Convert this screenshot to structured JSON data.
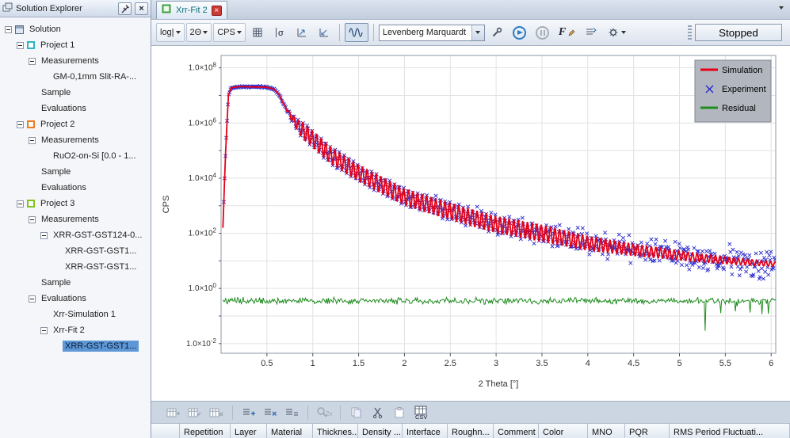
{
  "solution_explorer": {
    "title": "Solution Explorer",
    "close_label": "×",
    "tree": [
      {
        "label": "Solution",
        "level": 0,
        "expand": true,
        "icon": "solution"
      },
      {
        "label": "Project 1",
        "level": 1,
        "expand": true,
        "icon": "#2ab6c4"
      },
      {
        "label": "Measurements",
        "level": 2,
        "expand": true
      },
      {
        "label": "GM-0,1mm Slit-RA-...",
        "level": 3
      },
      {
        "label": "Sample",
        "level": 2
      },
      {
        "label": "Evaluations",
        "level": 2
      },
      {
        "label": "Project 2",
        "level": 1,
        "expand": true,
        "icon": "#f07a1e"
      },
      {
        "label": "Measurements",
        "level": 2,
        "expand": true
      },
      {
        "label": "RuO2-on-Si [0.0 - 1...",
        "level": 3
      },
      {
        "label": "Sample",
        "level": 2
      },
      {
        "label": "Evaluations",
        "level": 2
      },
      {
        "label": "Project 3",
        "level": 1,
        "expand": true,
        "icon": "#7fc41c"
      },
      {
        "label": "Measurements",
        "level": 2,
        "expand": true
      },
      {
        "label": "XRR-GST-GST124-0...",
        "level": 3,
        "expand": true
      },
      {
        "label": "XRR-GST-GST1...",
        "level": 4
      },
      {
        "label": "XRR-GST-GST1...",
        "level": 4
      },
      {
        "label": "Sample",
        "level": 2
      },
      {
        "label": "Evaluations",
        "level": 2,
        "expand": true
      },
      {
        "label": "Xrr-Simulation 1",
        "level": 3
      },
      {
        "label": "Xrr-Fit 2",
        "level": 3,
        "expand": true
      },
      {
        "label": "XRR-GST-GST1...",
        "level": 4,
        "selected": true
      }
    ]
  },
  "tabbar": {
    "active_tab": "Xrr-Fit 2",
    "close_label": "×"
  },
  "toolbar": {
    "log_label": "log|",
    "two_theta_label": "2Θ",
    "cps_label": "CPS",
    "algorithm": "Levenberg Marquardt",
    "f_label": "F",
    "status_button": "Stopped"
  },
  "bottom_toolbar": {
    "zoom_label": "2x",
    "csv_label": "CSV"
  },
  "table": {
    "headers": [
      "Repetition",
      "Layer",
      "Material",
      "Thicknes...",
      "Density ...",
      "Interface",
      "Roughn...",
      "Comment",
      "Color",
      "MNO",
      "PQR",
      "RMS Period Fluctuati..."
    ]
  },
  "chart_data": {
    "type": "line+scatter",
    "xlabel": "2 Theta [°]",
    "ylabel": "CPS",
    "x_min": 0,
    "x_max": 6.05,
    "x_ticks": [
      0.5,
      1,
      1.5,
      2,
      2.5,
      3,
      3.5,
      4,
      4.5,
      5,
      5.5,
      6
    ],
    "y_log_min": -2.35,
    "y_log_max": 8.45,
    "y_label_mantissa": "1.0×10",
    "y_label_exponents": [
      8,
      6,
      4,
      2,
      0,
      -2
    ],
    "grid": true,
    "legend": {
      "position": "top-right",
      "entries": [
        {
          "label": "Simulation",
          "color": "#e60017",
          "marker": "line"
        },
        {
          "label": "Experiment",
          "color": "#2a2ace",
          "marker": "x"
        },
        {
          "label": "Residual",
          "color": "#1e8c1e",
          "marker": "line"
        }
      ]
    },
    "simulation": {
      "envelope_log10": [
        [
          0.02,
          2.2
        ],
        [
          0.05,
          5.0
        ],
        [
          0.08,
          7.0
        ],
        [
          0.11,
          7.28
        ],
        [
          0.2,
          7.32
        ],
        [
          0.5,
          7.3
        ],
        [
          0.58,
          7.22
        ],
        [
          0.63,
          7.05
        ],
        [
          0.68,
          6.7
        ],
        [
          0.75,
          6.3
        ],
        [
          0.85,
          5.85
        ],
        [
          1.0,
          5.42
        ],
        [
          1.2,
          4.82
        ],
        [
          1.5,
          4.18
        ],
        [
          1.75,
          3.75
        ],
        [
          2.0,
          3.32
        ],
        [
          2.25,
          3.05
        ],
        [
          2.5,
          2.8
        ],
        [
          2.75,
          2.55
        ],
        [
          3.0,
          2.32
        ],
        [
          3.25,
          2.16
        ],
        [
          3.5,
          2.0
        ],
        [
          3.75,
          1.82
        ],
        [
          4.0,
          1.64
        ],
        [
          4.25,
          1.52
        ],
        [
          4.5,
          1.4
        ],
        [
          4.75,
          1.3
        ],
        [
          5.0,
          1.2
        ],
        [
          5.25,
          1.1
        ],
        [
          5.5,
          1.02
        ],
        [
          5.75,
          0.95
        ],
        [
          6.05,
          0.88
        ]
      ],
      "fringe_period": 0.05,
      "fringe_start": 0.68,
      "fringe_amp_max": 0.3,
      "fringe_amp_end": 0.08
    },
    "experiment": {
      "step": 0.009,
      "noise_log_min": 0.02,
      "noise_log_max": 0.32
    },
    "residual": {
      "level_log10": -0.45,
      "noise_log10": 0.07,
      "dip_region_start": 5.2,
      "dip_depth": 1.2
    }
  }
}
